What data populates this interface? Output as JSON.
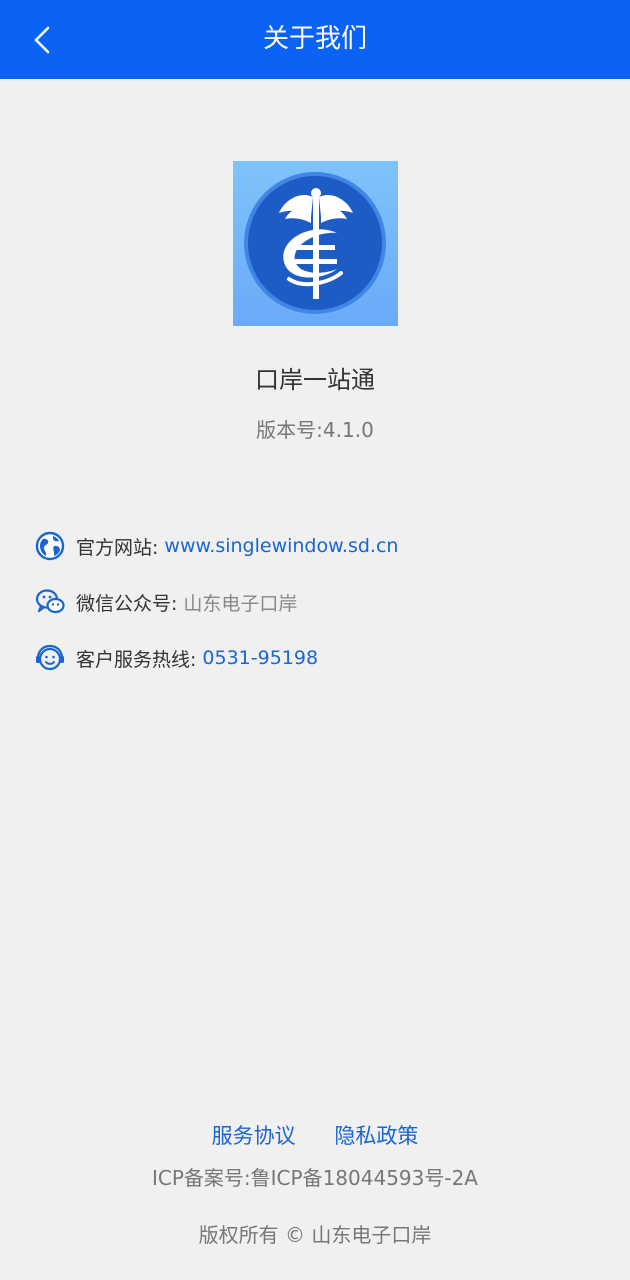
{
  "header": {
    "title": "关于我们"
  },
  "app": {
    "name": "口岸一站通",
    "version": "版本号:4.1.0"
  },
  "info": {
    "website": {
      "label": "官方网站:",
      "value": "www.singlewindow.sd.cn"
    },
    "wechat": {
      "label": "微信公众号:",
      "value": "山东电子口岸"
    },
    "hotline": {
      "label": "客户服务热线:",
      "value": "0531-95198"
    }
  },
  "footer": {
    "service_agreement": "服务协议",
    "privacy_policy": "隐私政策",
    "icp": "ICP备案号:鲁ICP备18044593号-2A",
    "copyright": "版权所有 © 山东电子口岸"
  },
  "colors": {
    "header": "#0a63f5",
    "link": "#1a66d0",
    "background": "#f0f0f0"
  }
}
